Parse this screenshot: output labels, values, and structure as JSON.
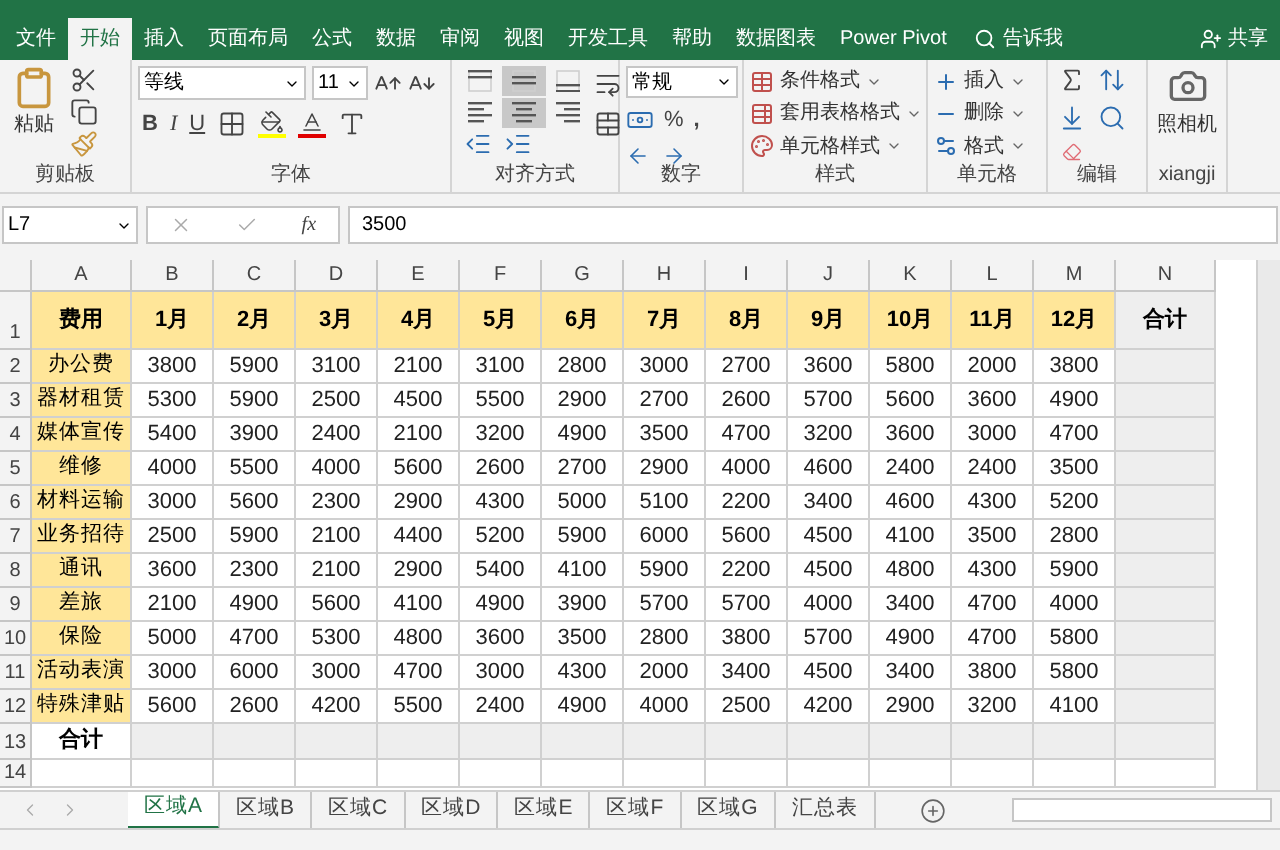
{
  "ribbon_tabs": [
    {
      "label": "文件",
      "selected": false
    },
    {
      "label": "开始",
      "selected": true
    },
    {
      "label": "插入",
      "selected": false
    },
    {
      "label": "页面布局",
      "selected": false
    },
    {
      "label": "公式",
      "selected": false
    },
    {
      "label": "数据",
      "selected": false
    },
    {
      "label": "审阅",
      "selected": false
    },
    {
      "label": "视图",
      "selected": false
    },
    {
      "label": "开发工具",
      "selected": false
    },
    {
      "label": "帮助",
      "selected": false
    },
    {
      "label": "数据图表",
      "selected": false
    },
    {
      "label": "Power Pivot",
      "selected": false
    }
  ],
  "tell_me": "告诉我",
  "share": "共享",
  "ribbon": {
    "clipboard": {
      "label": "剪贴板",
      "paste": "粘贴"
    },
    "font": {
      "label": "字体",
      "name": "等线",
      "size": "11",
      "bold": "B",
      "italic": "I",
      "underline": "U"
    },
    "alignment": {
      "label": "对齐方式",
      "buttons": [
        {
          "kind": "top",
          "selected": false
        },
        {
          "kind": "middle",
          "selected": true
        },
        {
          "kind": "bottom",
          "selected": false
        },
        {
          "kind": "left",
          "selected": false
        },
        {
          "kind": "center",
          "selected": true
        },
        {
          "kind": "right",
          "selected": false
        }
      ]
    },
    "number": {
      "label": "数字",
      "format": "常规",
      "percent": "%",
      "comma": ","
    },
    "styles": {
      "label": "样式",
      "items": [
        "条件格式",
        "套用表格格式",
        "单元格样式"
      ]
    },
    "cells": {
      "label": "单元格",
      "items": [
        "插入",
        "删除",
        "格式"
      ]
    },
    "editing": {
      "label": "编辑"
    },
    "camera": {
      "label": "xiangji",
      "button": "照相机"
    }
  },
  "formula_bar": {
    "name_box": "L7",
    "fx": "fx",
    "value": "3500"
  },
  "grid": {
    "columns": [
      "A",
      "B",
      "C",
      "D",
      "E",
      "F",
      "G",
      "H",
      "I",
      "J",
      "K",
      "L",
      "M",
      "N"
    ],
    "header_row": {
      "number": "1",
      "cells": [
        "费用",
        "1月",
        "2月",
        "3月",
        "4月",
        "5月",
        "6月",
        "7月",
        "8月",
        "9月",
        "10月",
        "11月",
        "12月",
        "合计"
      ]
    },
    "rows": [
      {
        "number": "2",
        "label": "办公费",
        "values": [
          "3800",
          "5900",
          "3100",
          "2100",
          "3100",
          "2800",
          "3000",
          "2700",
          "3600",
          "5800",
          "2000",
          "3800"
        ]
      },
      {
        "number": "3",
        "label": "器材租赁",
        "values": [
          "5300",
          "5900",
          "2500",
          "4500",
          "5500",
          "2900",
          "2700",
          "2600",
          "5700",
          "5600",
          "3600",
          "4900"
        ]
      },
      {
        "number": "4",
        "label": "媒体宣传",
        "values": [
          "5400",
          "3900",
          "2400",
          "2100",
          "3200",
          "4900",
          "3500",
          "4700",
          "3200",
          "3600",
          "3000",
          "4700"
        ]
      },
      {
        "number": "5",
        "label": "维修",
        "values": [
          "4000",
          "5500",
          "4000",
          "5600",
          "2600",
          "2700",
          "2900",
          "4000",
          "4600",
          "2400",
          "2400",
          "3500"
        ]
      },
      {
        "number": "6",
        "label": "材料运输",
        "values": [
          "3000",
          "5600",
          "2300",
          "2900",
          "4300",
          "5000",
          "5100",
          "2200",
          "3400",
          "4600",
          "4300",
          "5200"
        ]
      },
      {
        "number": "7",
        "label": "业务招待",
        "values": [
          "2500",
          "5900",
          "2100",
          "4400",
          "5200",
          "5900",
          "6000",
          "5600",
          "4500",
          "4100",
          "3500",
          "2800"
        ]
      },
      {
        "number": "8",
        "label": "通讯",
        "values": [
          "3600",
          "2300",
          "2100",
          "2900",
          "5400",
          "4100",
          "5900",
          "2200",
          "4500",
          "4800",
          "4300",
          "5900"
        ]
      },
      {
        "number": "9",
        "label": "差旅",
        "values": [
          "2100",
          "4900",
          "5600",
          "4100",
          "4900",
          "3900",
          "5700",
          "5700",
          "4000",
          "3400",
          "4700",
          "4000"
        ]
      },
      {
        "number": "10",
        "label": "保险",
        "values": [
          "5000",
          "4700",
          "5300",
          "4800",
          "3600",
          "3500",
          "2800",
          "3800",
          "5700",
          "4900",
          "4700",
          "5800"
        ]
      },
      {
        "number": "11",
        "label": "活动表演",
        "values": [
          "3000",
          "6000",
          "3000",
          "4700",
          "3000",
          "4300",
          "2000",
          "3400",
          "4500",
          "3400",
          "3800",
          "5800"
        ]
      },
      {
        "number": "12",
        "label": "特殊津贴",
        "values": [
          "5600",
          "2600",
          "4200",
          "5500",
          "2400",
          "4900",
          "4000",
          "2500",
          "4200",
          "2900",
          "3200",
          "4100"
        ]
      }
    ],
    "total_row": {
      "number": "13",
      "label": "合计"
    },
    "empty_rows": [
      "14"
    ]
  },
  "sheet_tabs": [
    {
      "label": "区域A",
      "selected": true
    },
    {
      "label": "区域B",
      "selected": false
    },
    {
      "label": "区域C",
      "selected": false
    },
    {
      "label": "区域D",
      "selected": false
    },
    {
      "label": "区域E",
      "selected": false
    },
    {
      "label": "区域F",
      "selected": false
    },
    {
      "label": "区域G",
      "selected": false
    },
    {
      "label": "汇总表",
      "selected": false
    }
  ]
}
